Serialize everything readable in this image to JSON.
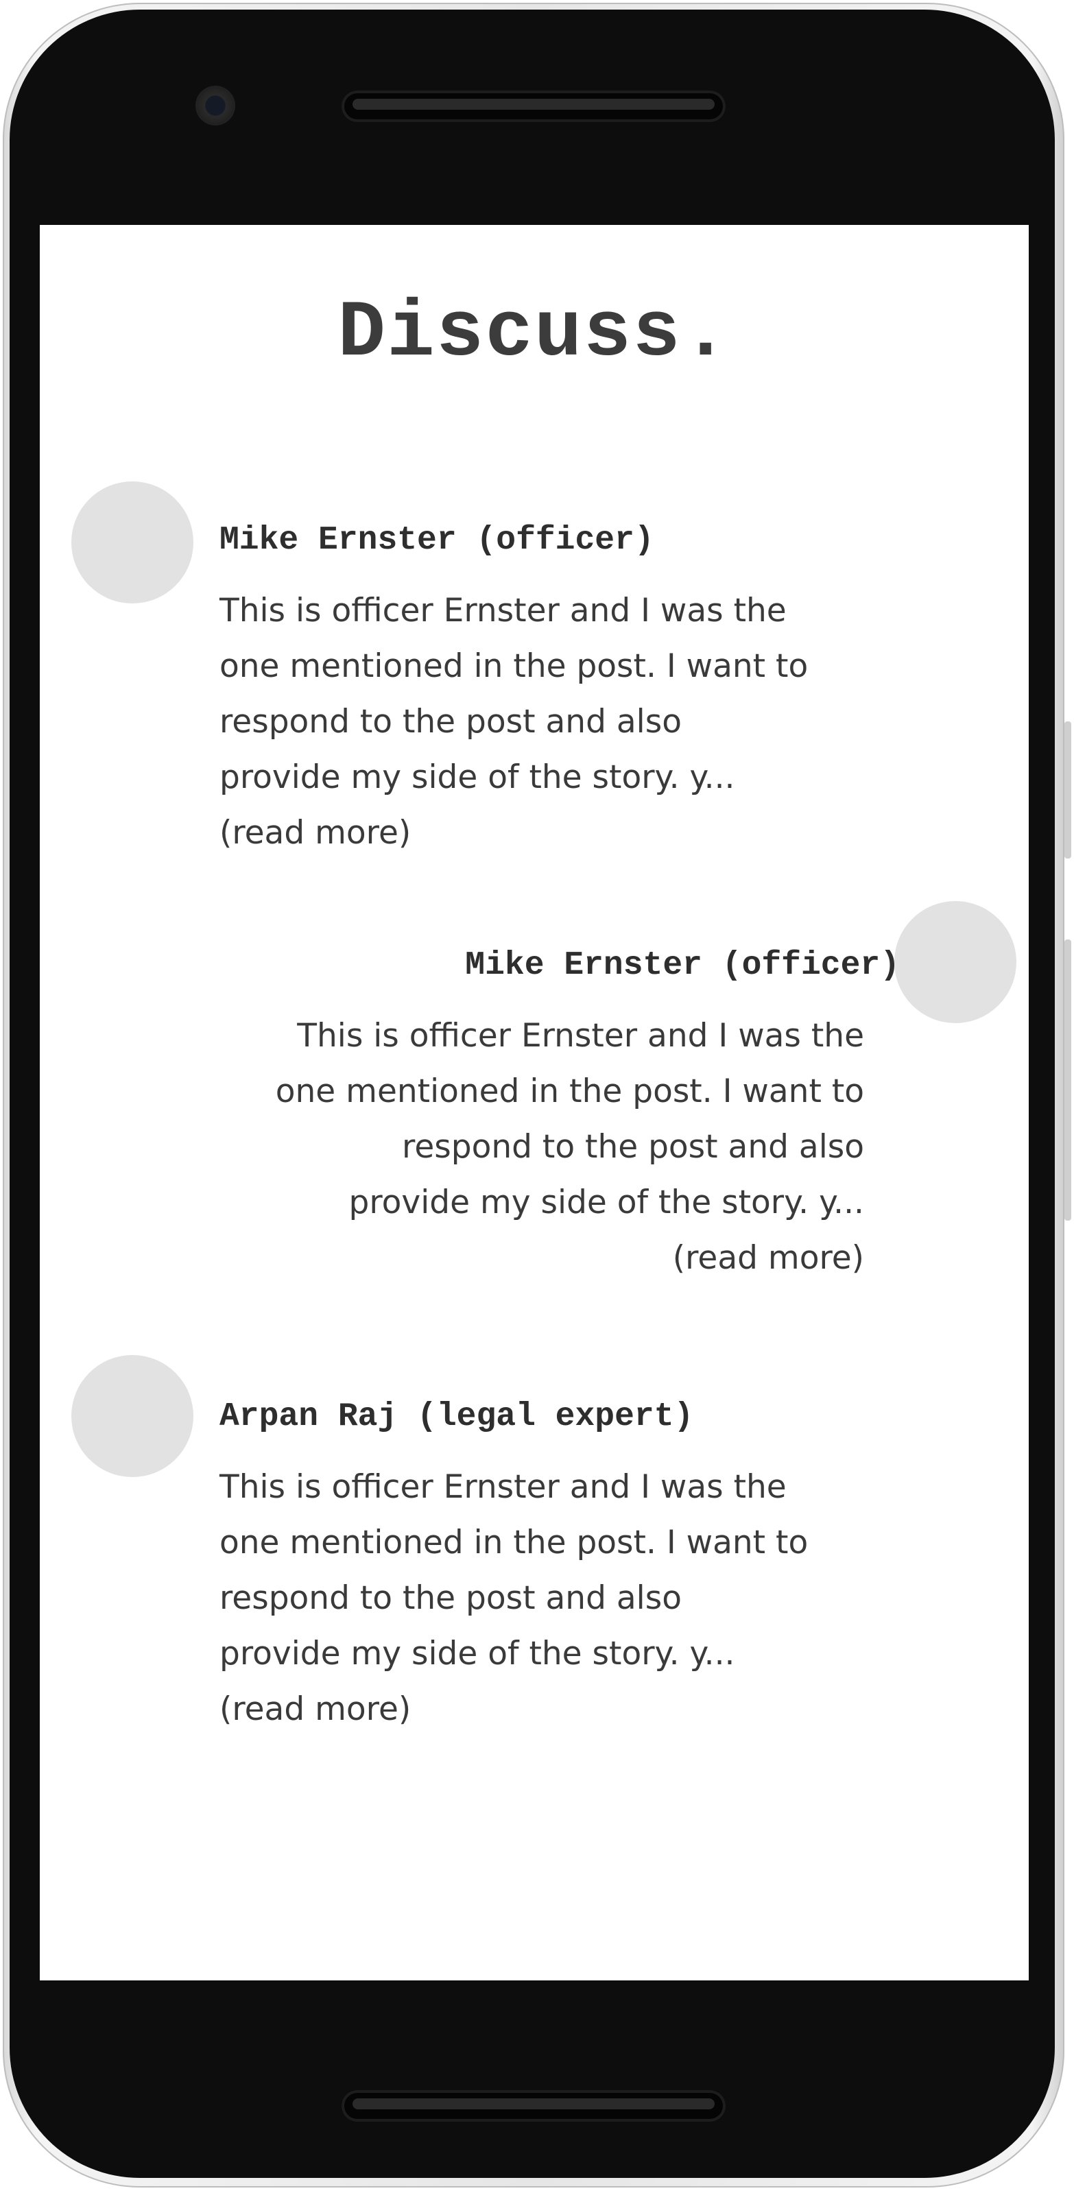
{
  "page": {
    "title": "Discuss."
  },
  "comments": [
    {
      "author": "Mike Ernster (officer)",
      "lines": [
        "This is officer Ernster and I was the",
        "one mentioned in the post. I want to",
        "respond to the post and also",
        "provide my side of the story. y..."
      ],
      "read_more": "(read more)",
      "align": "left"
    },
    {
      "author": "Mike Ernster (officer)",
      "lines": [
        "This is officer Ernster and I was the",
        "one mentioned in the post. I want to",
        "respond to the post and also",
        "provide my side of the story. y..."
      ],
      "read_more": "(read more)",
      "align": "right"
    },
    {
      "author": "Arpan Raj (legal expert)",
      "lines": [
        "This is officer Ernster and I was the",
        "one mentioned in the post. I want to",
        "respond to the post and also",
        "provide my side of the story. y..."
      ],
      "read_more": "(read more)",
      "align": "left"
    }
  ],
  "colors": {
    "avatar_placeholder": "#e2e2e2",
    "heading": "#3c3c3c",
    "text": "#3a3a3a",
    "device_frame": "#0d0d0d"
  }
}
